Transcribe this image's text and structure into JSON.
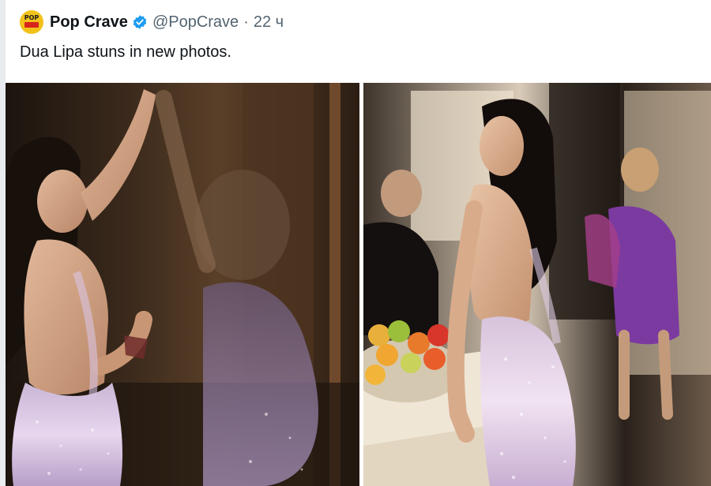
{
  "tweet": {
    "display_name": "Pop Crave",
    "handle": "@PopCrave",
    "separator": "·",
    "time": "22 ч",
    "text": "Dua Lipa stuns in new photos.",
    "avatar_text": "POP"
  },
  "icons": {
    "verified": "verified-badge-icon"
  },
  "colors": {
    "verified_blue": "#1d9bf0",
    "avatar_yellow": "#f2c21b",
    "text_primary": "#0f1419",
    "text_secondary": "#536471"
  }
}
